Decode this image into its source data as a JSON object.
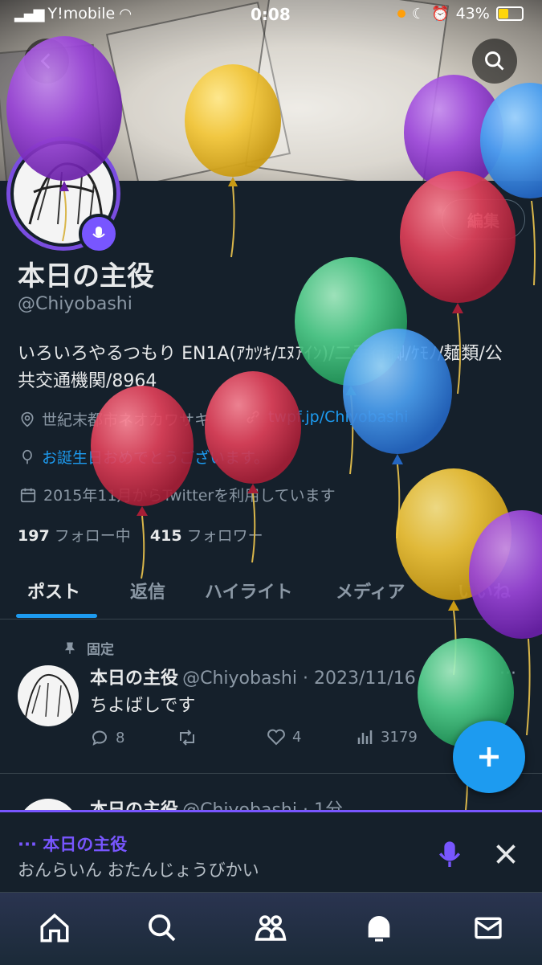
{
  "status_bar": {
    "carrier": "Y!mobile",
    "time": "0:08",
    "battery": "43%"
  },
  "profile": {
    "display_name": "本日の主役",
    "handle": "@Chiyobashi",
    "edit_label": "編集",
    "bio": "いろいろやるつもり EN1A(ｱｶﾂｷ/ｴﾇｱｲﾝ)/二手行脚/ｹﾓﾉ/麺類/公共交通機関/8964",
    "location": "世紀末都市ネオカワサキ",
    "website": "twpf.jp/Chiyobashi",
    "birthday": "お誕生日おめでとうございます。",
    "joined": "2015年11月からTwitterを利用しています",
    "following_count": "197",
    "following_label": "フォロー中",
    "followers_count": "415",
    "followers_label": "フォロワー"
  },
  "tabs": [
    "ポスト",
    "返信",
    "ハイライト",
    "メディア",
    "いいね"
  ],
  "pinned_label": "固定",
  "tweets": [
    {
      "name": "本日の主役",
      "handle_date": "@Chiyobashi · 2023/11/16",
      "text": "ちよばしです",
      "replies": "8",
      "likes": "4",
      "views": "3179"
    },
    {
      "name": "本日の主役",
      "handle_date": "@Chiyobashi · 1分"
    }
  ],
  "spaces": {
    "host": "··· 本日の主役",
    "title": "おんらいん おたんじょうびかい"
  },
  "colors": {
    "background": "#15202b",
    "accent": "#1d9bf0",
    "spaces_purple": "#7856ff"
  }
}
